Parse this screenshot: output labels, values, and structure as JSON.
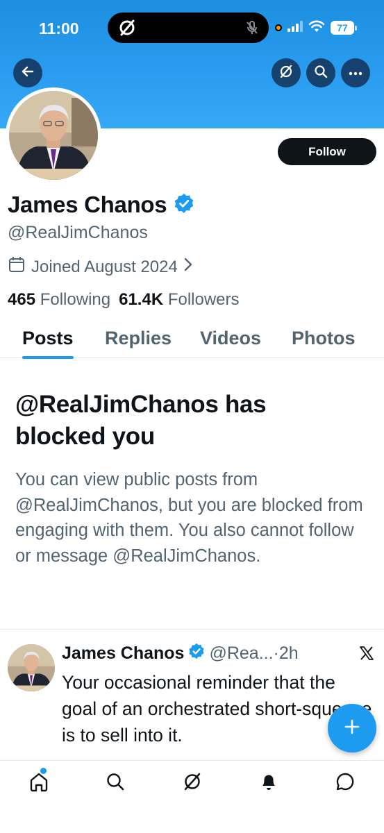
{
  "status_bar": {
    "time": "11:00",
    "battery": "77"
  },
  "header": {
    "back_icon": "arrow-left-icon",
    "grok_icon": "grok-icon",
    "search_icon": "search-icon",
    "more_icon": "more-horizontal-icon"
  },
  "profile": {
    "follow_label": "Follow",
    "name": "James Chanos",
    "handle": "@RealJimChanos",
    "joined": "Joined August 2024",
    "following_count": "465",
    "following_label": "Following",
    "followers_count": "61.4K",
    "followers_label": "Followers"
  },
  "tabs": [
    {
      "label": "Posts",
      "active": true
    },
    {
      "label": "Replies",
      "active": false
    },
    {
      "label": "Videos",
      "active": false
    },
    {
      "label": "Photos",
      "active": false
    }
  ],
  "blocked": {
    "title": "@RealJimChanos has blocked you",
    "body": "You can view public posts from @RealJimChanos, but you are blocked from engaging with them. You also cannot follow or message @RealJimChanos."
  },
  "post": {
    "author_name": "James Chanos",
    "author_handle": "@Rea...",
    "separator": "·",
    "time": "2h",
    "text": "Your occasional reminder that the goal of an orchestrated short-squeeze is to sell into it."
  },
  "bottom_nav": [
    {
      "name": "home-icon"
    },
    {
      "name": "search-icon"
    },
    {
      "name": "grok-icon"
    },
    {
      "name": "notifications-icon"
    },
    {
      "name": "messages-icon"
    }
  ],
  "colors": {
    "accent": "#1d9bf0",
    "text": "#0f1419",
    "secondary": "#536471",
    "banner": "#2a9cf0"
  }
}
